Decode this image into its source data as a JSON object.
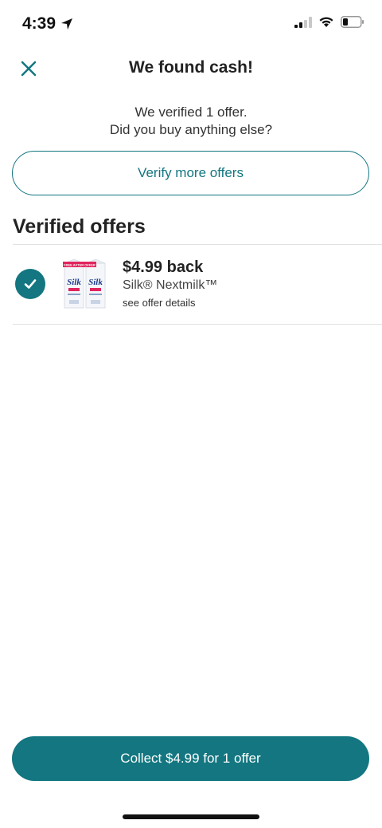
{
  "status_bar": {
    "time": "4:39",
    "location_icon": "location-arrow-icon",
    "signal_icon": "cellular-signal-icon",
    "wifi_icon": "wifi-icon",
    "battery_icon": "battery-icon"
  },
  "header": {
    "title": "We found cash!",
    "close_icon": "close-icon"
  },
  "subtitle": {
    "line1": "We verified 1 offer.",
    "line2": "Did you buy anything else?"
  },
  "verify_button": {
    "label": "Verify more offers"
  },
  "section": {
    "title": "Verified offers"
  },
  "offers": [
    {
      "amount": "$4.99 back",
      "name": "Silk® Nextmilk™",
      "details_link": "see offer details",
      "image_banner": "FREE AFTER OFFER",
      "image_brand": "Silk"
    }
  ],
  "collect_button": {
    "label": "Collect $4.99 for 1 offer"
  },
  "colors": {
    "accent": "#137680",
    "text": "#222222",
    "divider": "#e2e2e2",
    "product_banner": "#e0245e"
  }
}
